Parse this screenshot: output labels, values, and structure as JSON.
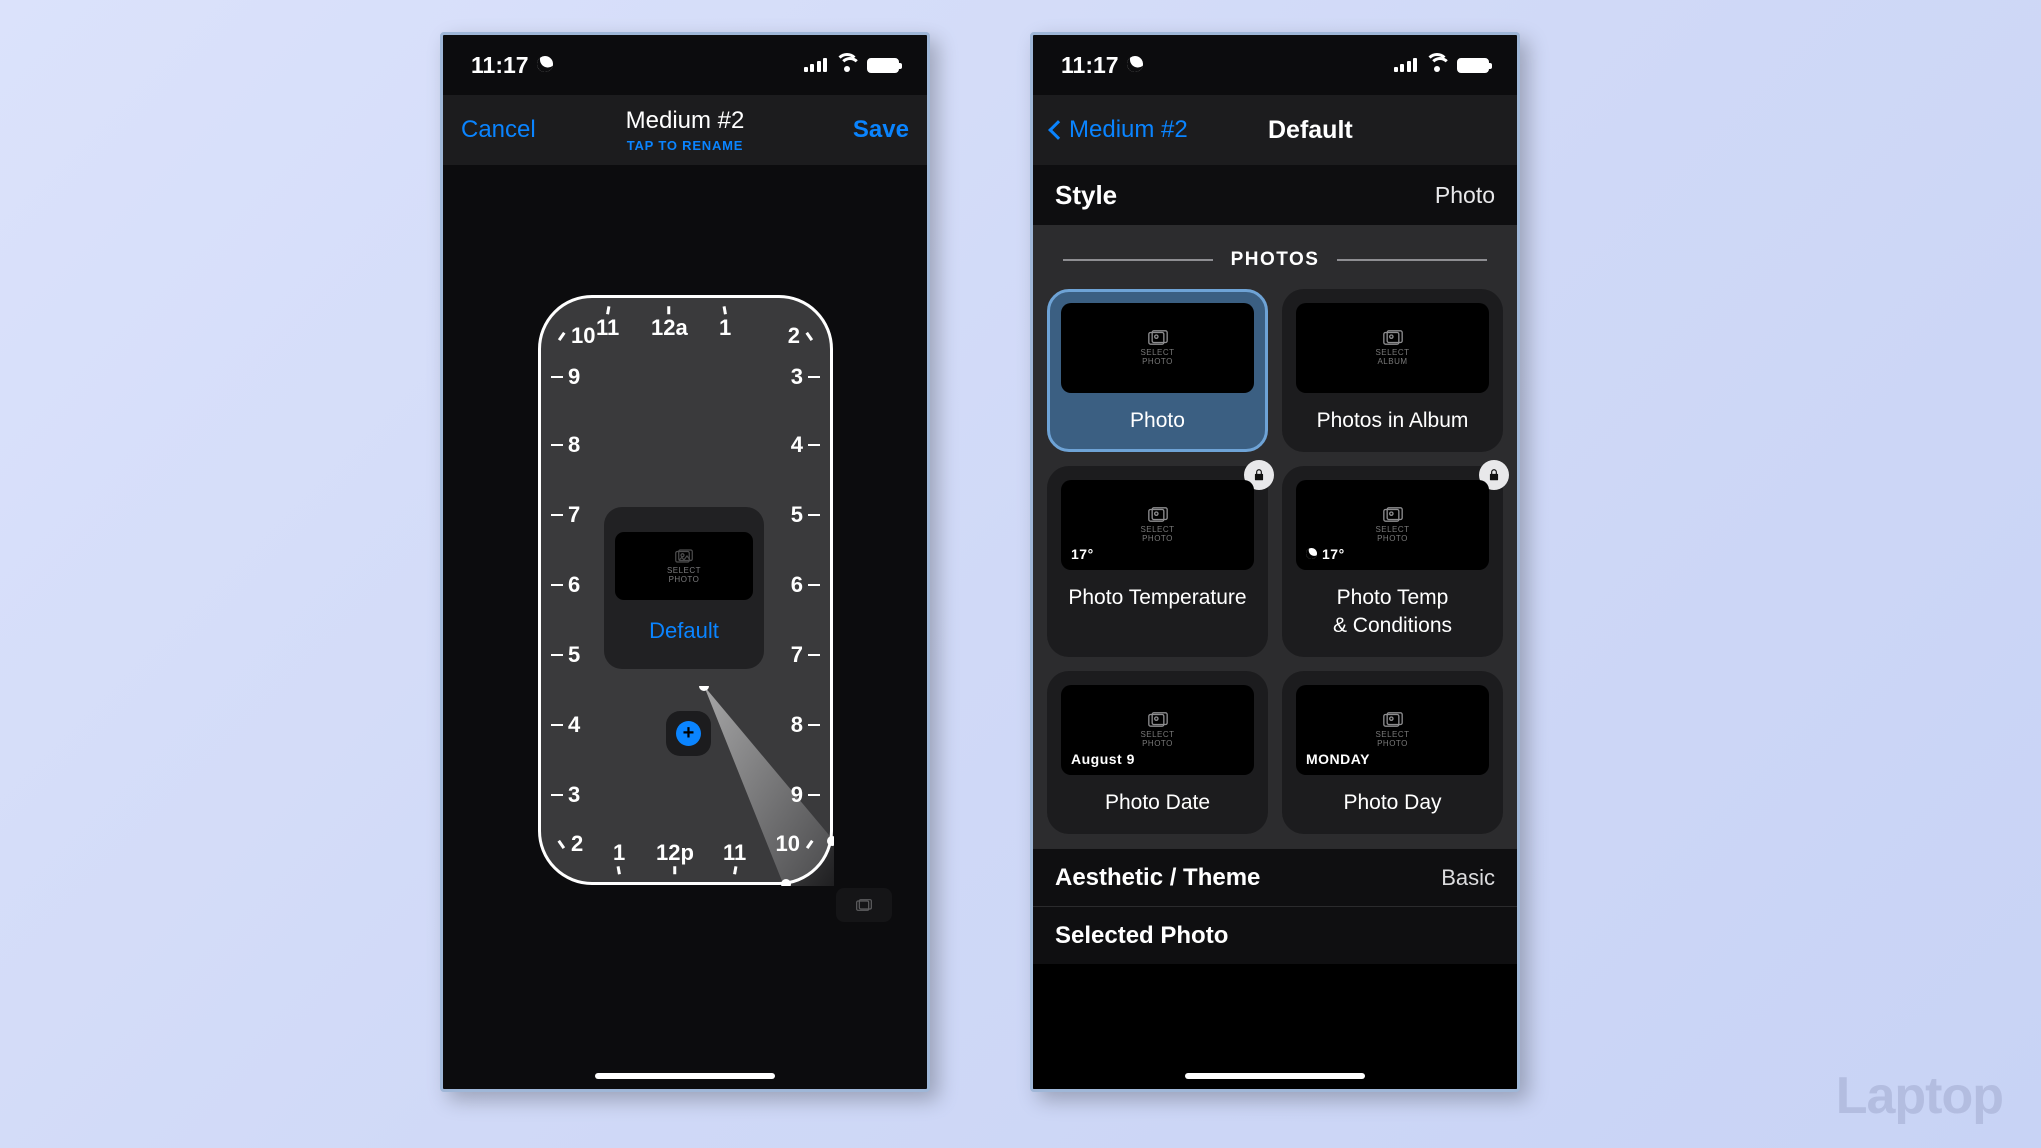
{
  "status": {
    "time": "11:17"
  },
  "left": {
    "nav": {
      "cancel": "Cancel",
      "title": "Medium #2",
      "subtitle": "TAP TO RENAME",
      "save": "Save"
    },
    "clock": {
      "10t": "10",
      "11t": "11",
      "12a": "12a",
      "1t": "1",
      "2t": "2",
      "9l": "9",
      "3r": "3",
      "8l": "8",
      "4r": "4",
      "7l": "7",
      "5r": "5",
      "6l": "6",
      "6r": "6",
      "5l": "5",
      "7r": "7",
      "4l": "4",
      "8r": "8",
      "3l": "3",
      "9r": "9",
      "2b": "2",
      "1b": "1",
      "12p": "12p",
      "11b": "11",
      "10b": "10"
    },
    "widget": {
      "label": "Default",
      "placeholder": "SELECT\nPHOTO"
    },
    "add": "+"
  },
  "right": {
    "nav": {
      "back": "Medium #2",
      "title": "Default"
    },
    "style_row": {
      "label": "Style",
      "value": "Photo"
    },
    "section": "PHOTOS",
    "cells": {
      "photo": "Photo",
      "album": "Photos in Album",
      "temp": "Photo Temperature",
      "tempcond": "Photo Temp\n& Conditions",
      "date": "Photo Date",
      "day": "Photo Day"
    },
    "overlays": {
      "temp": "17°",
      "tempcond": "17°",
      "date": "August 9",
      "day": "MONDAY"
    },
    "thumb_placeholder": "SELECT\nPHOTO",
    "thumb_placeholder_album": "SELECT\nALBUM",
    "aesthetic_row": {
      "label": "Aesthetic / Theme",
      "value": "Basic"
    },
    "selected_row": {
      "label": "Selected Photo"
    }
  },
  "watermark": "Laptop"
}
